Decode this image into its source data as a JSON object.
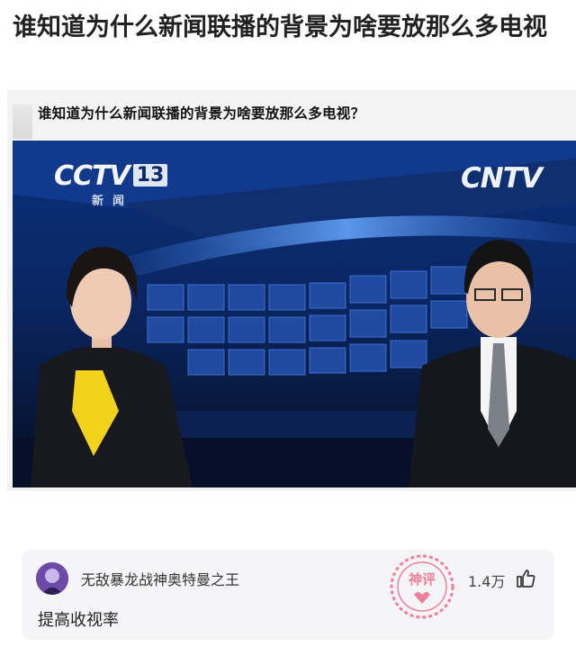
{
  "post": {
    "title": "谁知道为什么新闻联播的背景为啥要放那么多电视"
  },
  "screenshot": {
    "caption": "谁知道为什么新闻联播的背景为啥要放那么多电视？",
    "channel_logo": "CCTV",
    "channel_number": "13",
    "channel_sub": "新闻",
    "network_logo": "CNTV"
  },
  "comment": {
    "username": "无敌暴龙战神奥特曼之王",
    "text": "提高收视率",
    "likes": "1.4万",
    "badge_text": "神评",
    "icons": {
      "avatar": "avatar",
      "like": "thumbs-up-icon",
      "badge": "god-comment-stamp-icon"
    }
  },
  "colors": {
    "studio_blue": "#0d3f9e",
    "badge_pink": "#ee6b8c",
    "suit": "#15171c",
    "blouse": "#f2d21a"
  }
}
